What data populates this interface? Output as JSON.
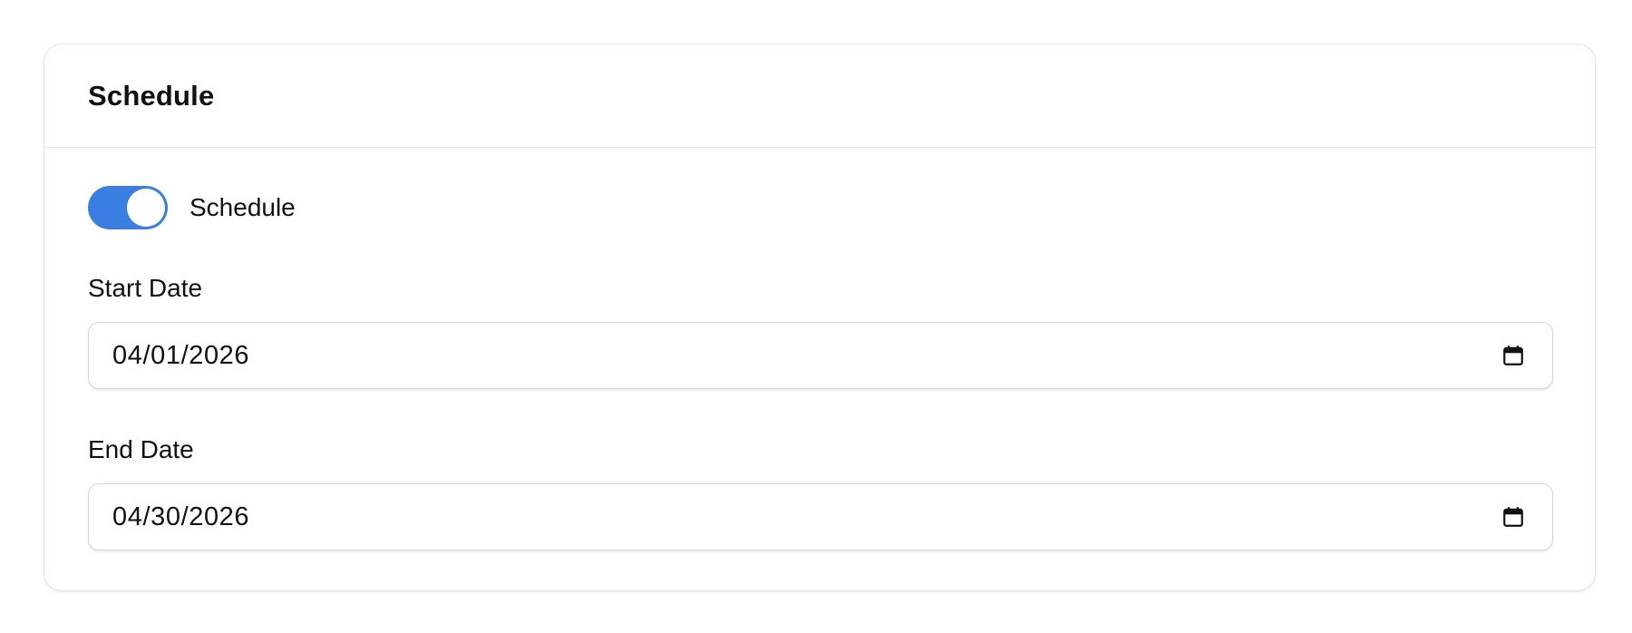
{
  "card": {
    "title": "Schedule"
  },
  "schedule_toggle": {
    "label": "Schedule",
    "enabled": true,
    "color": "#3b7ee2"
  },
  "start_date": {
    "label": "Start Date",
    "value": "04/01/2026",
    "icon": "calendar-icon"
  },
  "end_date": {
    "label": "End Date",
    "value": "04/30/2026",
    "icon": "calendar-icon"
  }
}
